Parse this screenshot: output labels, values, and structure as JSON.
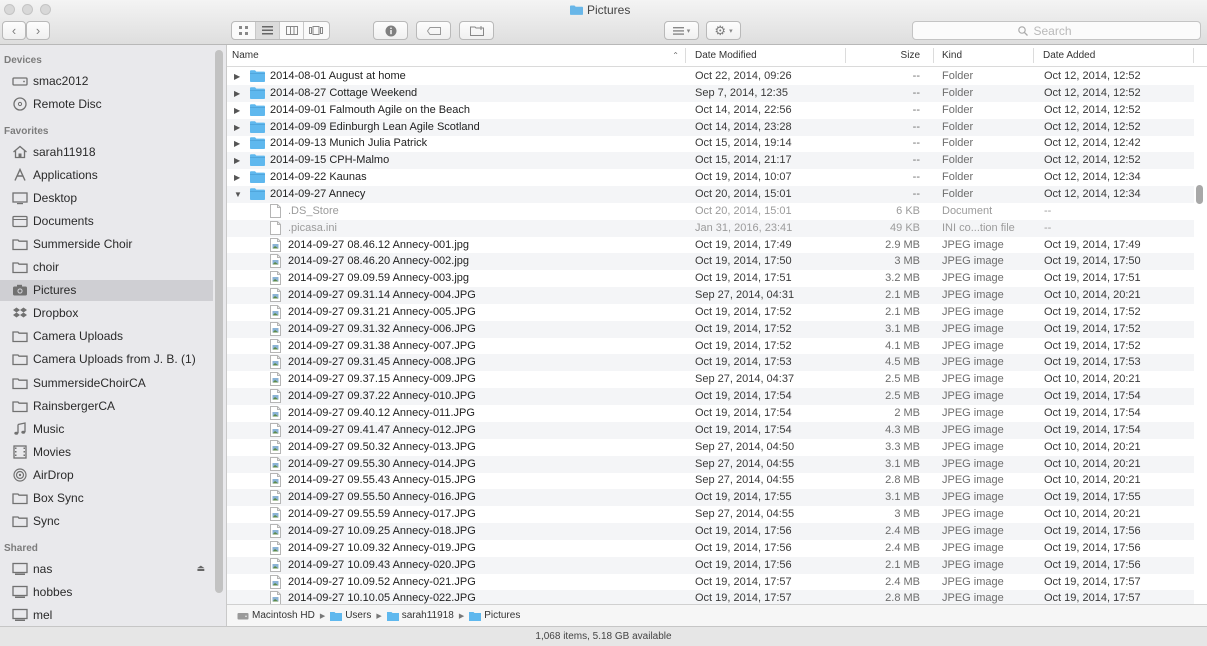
{
  "window": {
    "title": "Pictures"
  },
  "search": {
    "placeholder": "Search"
  },
  "sidebar": {
    "devices_label": "Devices",
    "devices": [
      {
        "label": "smac2012",
        "icon": "hard-drive-icon"
      },
      {
        "label": "Remote Disc",
        "icon": "disc-icon"
      }
    ],
    "favorites_label": "Favorites",
    "favorites": [
      {
        "label": "sarah11918",
        "icon": "home-icon"
      },
      {
        "label": "Applications",
        "icon": "applications-icon"
      },
      {
        "label": "Desktop",
        "icon": "desktop-icon"
      },
      {
        "label": "Documents",
        "icon": "documents-icon"
      },
      {
        "label": "Summerside Choir",
        "icon": "folder-icon"
      },
      {
        "label": "choir",
        "icon": "folder-icon"
      },
      {
        "label": "Pictures",
        "icon": "camera-icon",
        "selected": true
      },
      {
        "label": "Dropbox",
        "icon": "dropbox-icon"
      },
      {
        "label": "Camera Uploads",
        "icon": "folder-icon"
      },
      {
        "label": "Camera Uploads from J. B. (1)",
        "icon": "folder-icon"
      },
      {
        "label": "SummersideChoirCA",
        "icon": "folder-icon"
      },
      {
        "label": "RainsbergerCA",
        "icon": "folder-icon"
      },
      {
        "label": "Music",
        "icon": "music-icon"
      },
      {
        "label": "Movies",
        "icon": "movies-icon"
      },
      {
        "label": "AirDrop",
        "icon": "airdrop-icon"
      },
      {
        "label": "Box Sync",
        "icon": "folder-icon"
      },
      {
        "label": "Sync",
        "icon": "folder-icon"
      }
    ],
    "shared_label": "Shared",
    "shared": [
      {
        "label": "nas",
        "icon": "server-icon",
        "eject": "⏏"
      },
      {
        "label": "hobbes",
        "icon": "server-icon"
      },
      {
        "label": "mel",
        "icon": "server-icon"
      }
    ]
  },
  "columns": {
    "name": "Name",
    "date_modified": "Date Modified",
    "size": "Size",
    "kind": "Kind",
    "date_added": "Date Added"
  },
  "files": [
    {
      "name": "2014-08-01 August at home",
      "modified": "Oct 22, 2014, 09:26",
      "size": "--",
      "kind": "Folder",
      "added": "Oct 12, 2014, 12:52",
      "type": "folder",
      "expanded": false
    },
    {
      "name": "2014-08-27 Cottage Weekend",
      "modified": "Sep 7, 2014, 12:35",
      "size": "--",
      "kind": "Folder",
      "added": "Oct 12, 2014, 12:52",
      "type": "folder",
      "expanded": false
    },
    {
      "name": "2014-09-01 Falmouth Agile on the Beach",
      "modified": "Oct 14, 2014, 22:56",
      "size": "--",
      "kind": "Folder",
      "added": "Oct 12, 2014, 12:52",
      "type": "folder",
      "expanded": false
    },
    {
      "name": "2014-09-09 Edinburgh Lean Agile Scotland",
      "modified": "Oct 14, 2014, 23:28",
      "size": "--",
      "kind": "Folder",
      "added": "Oct 12, 2014, 12:52",
      "type": "folder",
      "expanded": false
    },
    {
      "name": "2014-09-13 Munich Julia Patrick",
      "modified": "Oct 15, 2014, 19:14",
      "size": "--",
      "kind": "Folder",
      "added": "Oct 12, 2014, 12:42",
      "type": "folder",
      "expanded": false
    },
    {
      "name": "2014-09-15 CPH-Malmo",
      "modified": "Oct 15, 2014, 21:17",
      "size": "--",
      "kind": "Folder",
      "added": "Oct 12, 2014, 12:52",
      "type": "folder",
      "expanded": false
    },
    {
      "name": "2014-09-22 Kaunas",
      "modified": "Oct 19, 2014, 10:07",
      "size": "--",
      "kind": "Folder",
      "added": "Oct 12, 2014, 12:34",
      "type": "folder",
      "expanded": false
    },
    {
      "name": "2014-09-27 Annecy",
      "modified": "Oct 20, 2014, 15:01",
      "size": "--",
      "kind": "Folder",
      "added": "Oct 12, 2014, 12:34",
      "type": "folder",
      "expanded": true
    },
    {
      "name": ".DS_Store",
      "modified": "Oct 20, 2014, 15:01",
      "size": "6 KB",
      "kind": "Document",
      "added": "--",
      "type": "hidden"
    },
    {
      "name": ".picasa.ini",
      "modified": "Jan 31, 2016, 23:41",
      "size": "49 KB",
      "kind": "INI co...tion file",
      "added": "--",
      "type": "hidden"
    },
    {
      "name": "2014-09-27 08.46.12 Annecy-001.jpg",
      "modified": "Oct 19, 2014, 17:49",
      "size": "2.9 MB",
      "kind": "JPEG image",
      "added": "Oct 19, 2014, 17:49",
      "type": "image"
    },
    {
      "name": "2014-09-27 08.46.20 Annecy-002.jpg",
      "modified": "Oct 19, 2014, 17:50",
      "size": "3 MB",
      "kind": "JPEG image",
      "added": "Oct 19, 2014, 17:50",
      "type": "image"
    },
    {
      "name": "2014-09-27 09.09.59 Annecy-003.jpg",
      "modified": "Oct 19, 2014, 17:51",
      "size": "3.2 MB",
      "kind": "JPEG image",
      "added": "Oct 19, 2014, 17:51",
      "type": "image"
    },
    {
      "name": "2014-09-27 09.31.14 Annecy-004.JPG",
      "modified": "Sep 27, 2014, 04:31",
      "size": "2.1 MB",
      "kind": "JPEG image",
      "added": "Oct 10, 2014, 20:21",
      "type": "image"
    },
    {
      "name": "2014-09-27 09.31.21 Annecy-005.JPG",
      "modified": "Oct 19, 2014, 17:52",
      "size": "2.1 MB",
      "kind": "JPEG image",
      "added": "Oct 19, 2014, 17:52",
      "type": "image"
    },
    {
      "name": "2014-09-27 09.31.32 Annecy-006.JPG",
      "modified": "Oct 19, 2014, 17:52",
      "size": "3.1 MB",
      "kind": "JPEG image",
      "added": "Oct 19, 2014, 17:52",
      "type": "image"
    },
    {
      "name": "2014-09-27 09.31.38 Annecy-007.JPG",
      "modified": "Oct 19, 2014, 17:52",
      "size": "4.1 MB",
      "kind": "JPEG image",
      "added": "Oct 19, 2014, 17:52",
      "type": "image"
    },
    {
      "name": "2014-09-27 09.31.45 Annecy-008.JPG",
      "modified": "Oct 19, 2014, 17:53",
      "size": "4.5 MB",
      "kind": "JPEG image",
      "added": "Oct 19, 2014, 17:53",
      "type": "image"
    },
    {
      "name": "2014-09-27 09.37.15 Annecy-009.JPG",
      "modified": "Sep 27, 2014, 04:37",
      "size": "2.5 MB",
      "kind": "JPEG image",
      "added": "Oct 10, 2014, 20:21",
      "type": "image"
    },
    {
      "name": "2014-09-27 09.37.22 Annecy-010.JPG",
      "modified": "Oct 19, 2014, 17:54",
      "size": "2.5 MB",
      "kind": "JPEG image",
      "added": "Oct 19, 2014, 17:54",
      "type": "image"
    },
    {
      "name": "2014-09-27 09.40.12 Annecy-011.JPG",
      "modified": "Oct 19, 2014, 17:54",
      "size": "2 MB",
      "kind": "JPEG image",
      "added": "Oct 19, 2014, 17:54",
      "type": "image"
    },
    {
      "name": "2014-09-27 09.41.47 Annecy-012.JPG",
      "modified": "Oct 19, 2014, 17:54",
      "size": "4.3 MB",
      "kind": "JPEG image",
      "added": "Oct 19, 2014, 17:54",
      "type": "image"
    },
    {
      "name": "2014-09-27 09.50.32 Annecy-013.JPG",
      "modified": "Sep 27, 2014, 04:50",
      "size": "3.3 MB",
      "kind": "JPEG image",
      "added": "Oct 10, 2014, 20:21",
      "type": "image"
    },
    {
      "name": "2014-09-27 09.55.30 Annecy-014.JPG",
      "modified": "Sep 27, 2014, 04:55",
      "size": "3.1 MB",
      "kind": "JPEG image",
      "added": "Oct 10, 2014, 20:21",
      "type": "image"
    },
    {
      "name": "2014-09-27 09.55.43 Annecy-015.JPG",
      "modified": "Sep 27, 2014, 04:55",
      "size": "2.8 MB",
      "kind": "JPEG image",
      "added": "Oct 10, 2014, 20:21",
      "type": "image"
    },
    {
      "name": "2014-09-27 09.55.50 Annecy-016.JPG",
      "modified": "Oct 19, 2014, 17:55",
      "size": "3.1 MB",
      "kind": "JPEG image",
      "added": "Oct 19, 2014, 17:55",
      "type": "image"
    },
    {
      "name": "2014-09-27 09.55.59 Annecy-017.JPG",
      "modified": "Sep 27, 2014, 04:55",
      "size": "3 MB",
      "kind": "JPEG image",
      "added": "Oct 10, 2014, 20:21",
      "type": "image"
    },
    {
      "name": "2014-09-27 10.09.25 Annecy-018.JPG",
      "modified": "Oct 19, 2014, 17:56",
      "size": "2.4 MB",
      "kind": "JPEG image",
      "added": "Oct 19, 2014, 17:56",
      "type": "image"
    },
    {
      "name": "2014-09-27 10.09.32 Annecy-019.JPG",
      "modified": "Oct 19, 2014, 17:56",
      "size": "2.4 MB",
      "kind": "JPEG image",
      "added": "Oct 19, 2014, 17:56",
      "type": "image"
    },
    {
      "name": "2014-09-27 10.09.43 Annecy-020.JPG",
      "modified": "Oct 19, 2014, 17:56",
      "size": "2.1 MB",
      "kind": "JPEG image",
      "added": "Oct 19, 2014, 17:56",
      "type": "image"
    },
    {
      "name": "2014-09-27 10.09.52 Annecy-021.JPG",
      "modified": "Oct 19, 2014, 17:57",
      "size": "2.4 MB",
      "kind": "JPEG image",
      "added": "Oct 19, 2014, 17:57",
      "type": "image"
    },
    {
      "name": "2014-09-27 10.10.05 Annecy-022.JPG",
      "modified": "Oct 19, 2014, 17:57",
      "size": "2.8 MB",
      "kind": "JPEG image",
      "added": "Oct 19, 2014, 17:57",
      "type": "image"
    }
  ],
  "path": [
    "Macintosh HD",
    "Users",
    "sarah11918",
    "Pictures"
  ],
  "status": {
    "text": "1,068 items, 5.18 GB available"
  },
  "colors": {
    "folder": "#5fb8ee",
    "selection": "#cfcfd3",
    "alternate_row": "#f4f5f7"
  }
}
